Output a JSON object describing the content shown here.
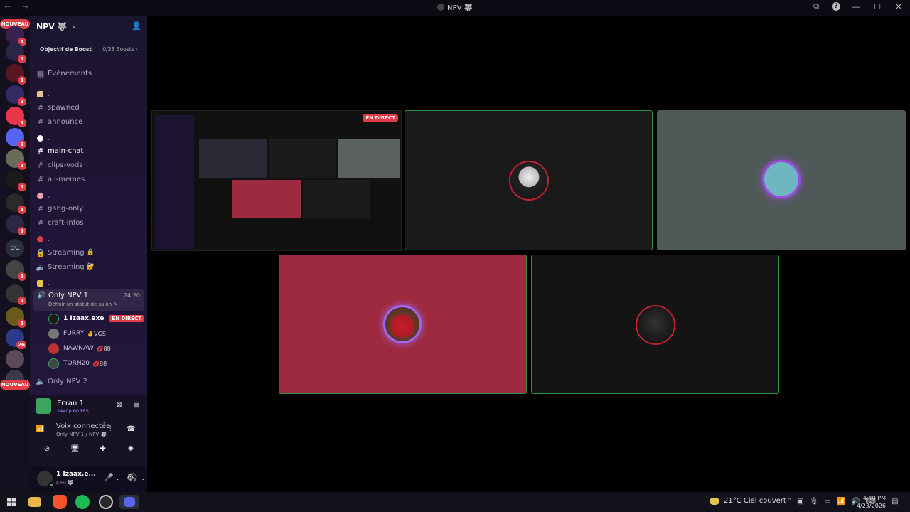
{
  "window": {
    "title": "NPV 🐺",
    "nav": "← →",
    "controls": [
      "⧉",
      "?",
      "—",
      "☐",
      "✕"
    ]
  },
  "guilds": {
    "nouveau_top": "NOUVEAU",
    "nouveau_bottom": "NOUVEAU",
    "bc_label": "BC",
    "badges": [
      "1",
      "1",
      "1",
      "1",
      "1",
      "1",
      "1",
      "1",
      "1",
      "1",
      "1",
      "1",
      "1",
      "1",
      "26"
    ]
  },
  "server": {
    "name": "NPV 🐺",
    "boost_goal": "Objectif de Boost",
    "boost_count": "0/33 Boosts ›"
  },
  "channels": {
    "events": "Événements",
    "spawned": "spawned",
    "announce": "announce",
    "main_chat": "main-chat",
    "clips_vods": "clips-vods",
    "all_memes": "all-memes",
    "gang_only": "gang-only",
    "craft_infos": "craft-infos",
    "streaming1": "Streaming",
    "streaming2": "Streaming",
    "only_npv_1": "Only NPV 1",
    "only_npv_1_timer": "24:20",
    "only_npv_1_status": "Définir un statut de salon ✎",
    "only_npv_2": "Only NPV 2"
  },
  "members": [
    {
      "name": "1 Izaax.exe",
      "tag": "",
      "live": "EN DIRECT",
      "color": "#1a1a1a"
    },
    {
      "name": "FURRY",
      "tag": "🤞VGS",
      "live": "",
      "color": "#777"
    },
    {
      "name": "NAWNAW",
      "tag": "💋88",
      "live": "",
      "color": "#b33"
    },
    {
      "name": "TORN20",
      "tag": "💋88",
      "live": "",
      "color": "#444"
    }
  ],
  "panel": {
    "screen_title": "Ecran 1",
    "screen_sub": "1440p 60 FPS",
    "voice_title": "Voix connectée",
    "voice_sub": "Only NPV 1 / NPV 🐺",
    "user_name": "1 Izaax.e...",
    "user_sub": "𝕂ℍ𝕃🐺"
  },
  "stream": {
    "live_badge": "EN DIRECT"
  },
  "taskbar": {
    "weather": "21°C  Ciel couvert",
    "time": "4:40 PM",
    "date": "4/23/2026"
  },
  "colors": {
    "accent_live": "#e03d48",
    "speaking": "#2d8f4a",
    "tile_red": "#9e2a3f",
    "tile_gray": "#4f5a58"
  }
}
